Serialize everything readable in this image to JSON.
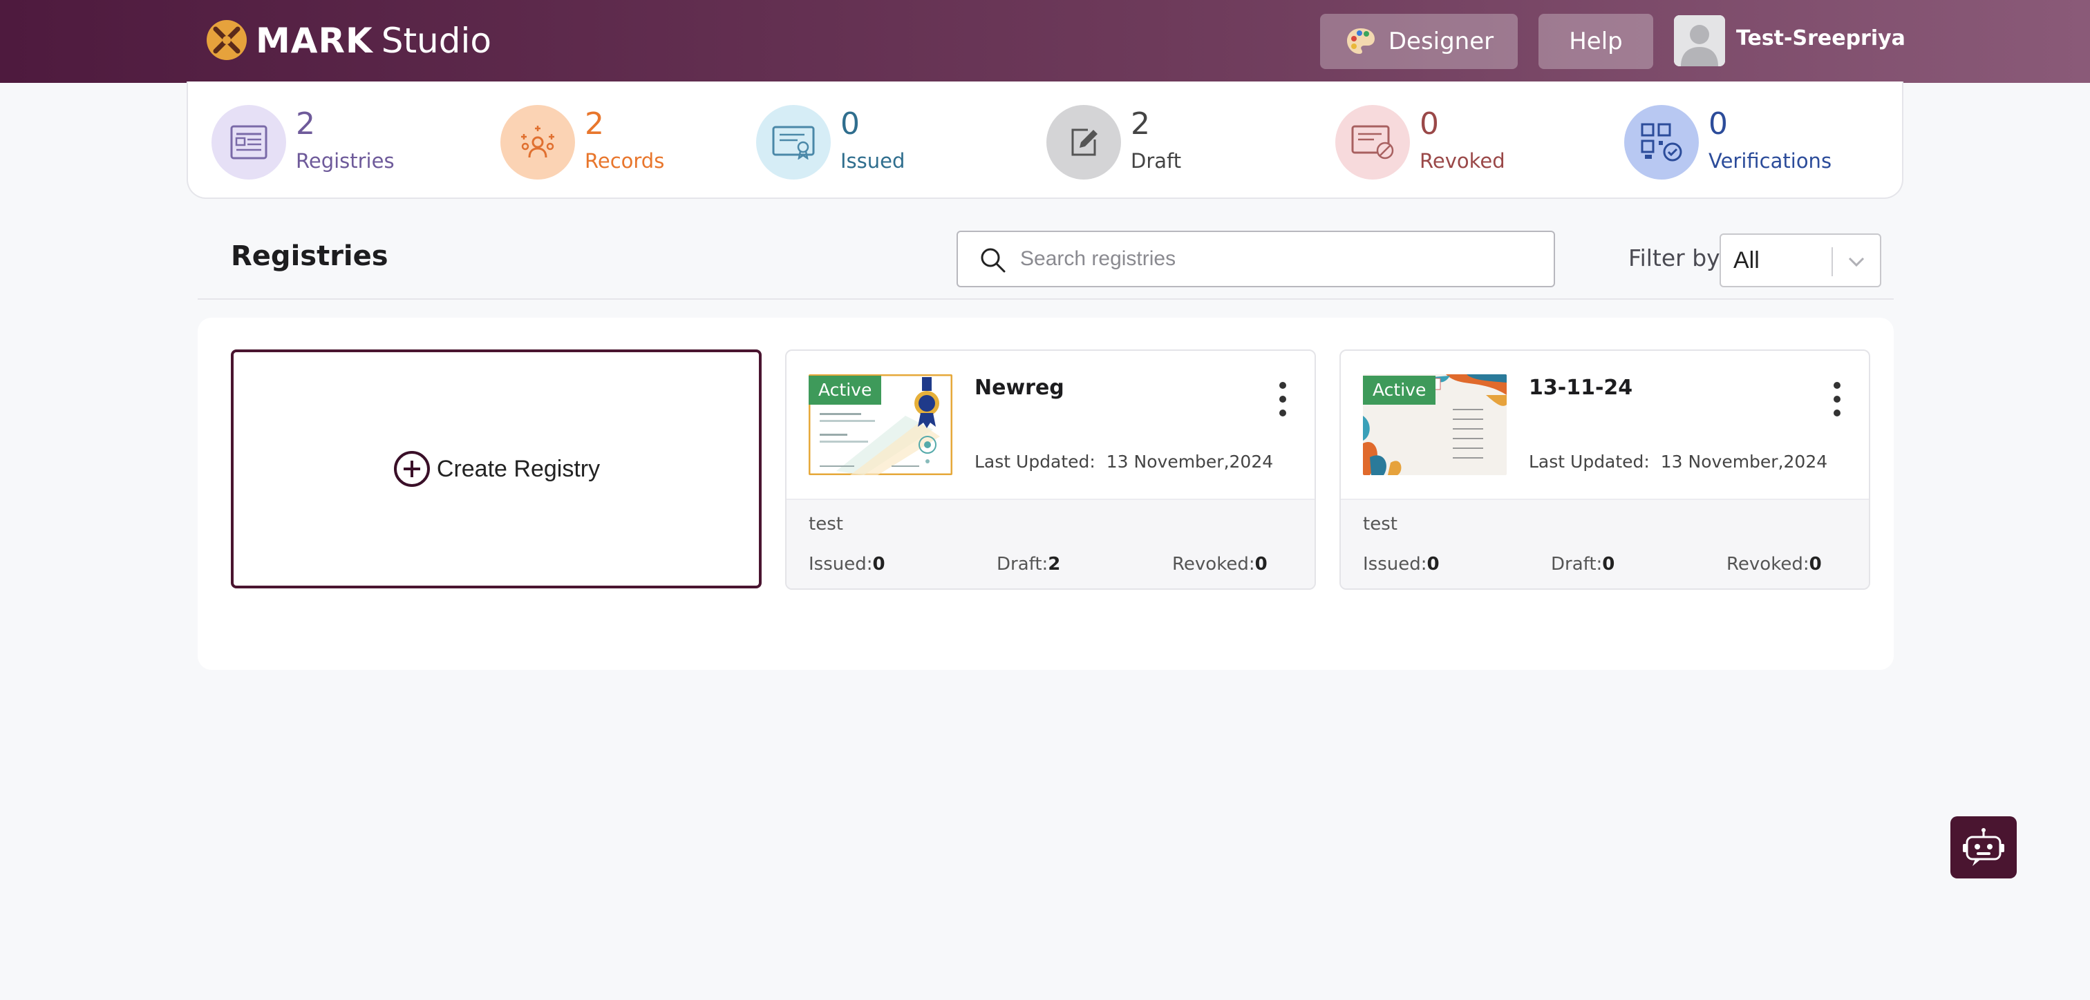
{
  "header": {
    "brand_bold": "MARK",
    "brand_light": "Studio",
    "designer_label": "Designer",
    "help_label": "Help",
    "username": "Test-Sreepriya"
  },
  "stats": [
    {
      "value": "2",
      "label": "Registries",
      "color": "#6e5a9a",
      "bg": "#e6e0f6",
      "icon": "registry-list-icon"
    },
    {
      "value": "2",
      "label": "Records",
      "color": "#e8762c",
      "bg": "#fbd3b4",
      "icon": "people-sparkle-icon"
    },
    {
      "value": "0",
      "label": "Issued",
      "color": "#2f6e8e",
      "bg": "#d6edf6",
      "icon": "certificate-icon"
    },
    {
      "value": "2",
      "label": "Draft",
      "color": "#444444",
      "bg": "#d4d4d6",
      "icon": "edit-icon"
    },
    {
      "value": "0",
      "label": "Revoked",
      "color": "#9a4848",
      "bg": "#f7dadc",
      "icon": "revoked-document-icon"
    },
    {
      "value": "0",
      "label": "Verifications",
      "color": "#2c4c9a",
      "bg": "#b8c8f2",
      "icon": "qr-verify-icon"
    }
  ],
  "registries": {
    "title": "Registries",
    "search_placeholder": "Search registries",
    "filter_label": "Filter by",
    "filter_value": "All",
    "create_label": "Create Registry",
    "cards": [
      {
        "status": "Active",
        "name": "Newreg",
        "updated_label": "Last Updated:",
        "updated_value": "13 November,2024",
        "description": "test",
        "issued_label": "Issued:",
        "issued": "0",
        "draft_label": "Draft:",
        "draft": "2",
        "revoked_label": "Revoked:",
        "revoked": "0"
      },
      {
        "status": "Active",
        "name": "13-11-24",
        "updated_label": "Last Updated:",
        "updated_value": "13 November,2024",
        "description": "test",
        "issued_label": "Issued:",
        "issued": "0",
        "draft_label": "Draft:",
        "draft": "0",
        "revoked_label": "Revoked:",
        "revoked": "0"
      }
    ]
  }
}
